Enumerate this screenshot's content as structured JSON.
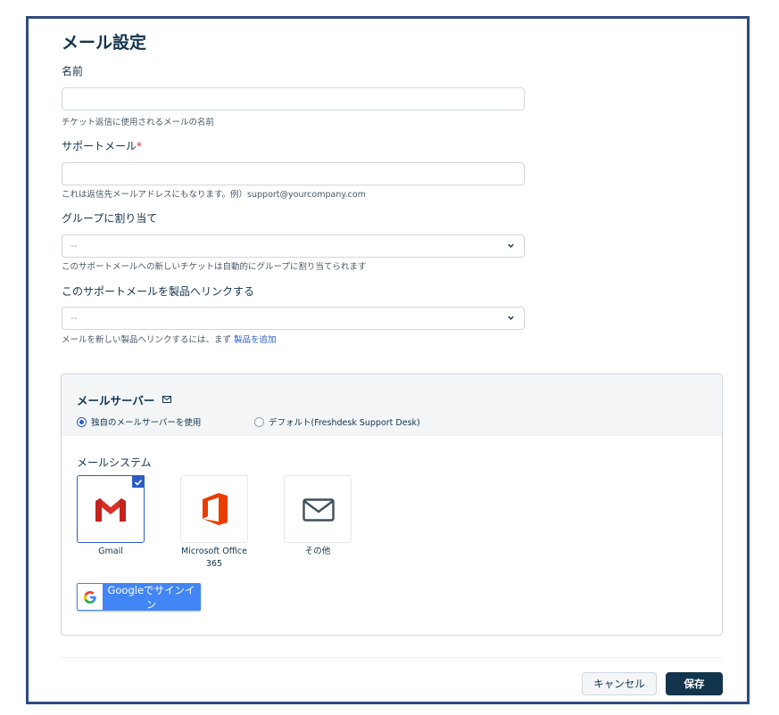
{
  "page": {
    "title": "メール設定"
  },
  "form": {
    "name": {
      "label": "名前",
      "value": "",
      "hint": "チケット返信に使用されるメールの名前"
    },
    "support_email": {
      "label": "サポートメール",
      "required_mark": "*",
      "value": "",
      "hint": "これは返信先メールアドレスにもなります。例）support@yourcompany.com"
    },
    "group": {
      "label": "グループに割り当て",
      "selected": "--",
      "hint": "このサポートメールへの新しいチケットは自動的にグループに割り当てられます"
    },
    "product": {
      "label": "このサポートメールを製品へリンクする",
      "selected": "--",
      "hint_prefix": "メールを新しい製品へリンクするには、まず ",
      "hint_link": "製品を追加"
    }
  },
  "mail_server": {
    "title": "メールサーバー",
    "icon": "envelope-icon",
    "options": [
      {
        "label": "独自のメールサーバーを使用",
        "selected": true
      },
      {
        "label": "デフォルト(Freshdesk Support Desk)",
        "selected": false
      }
    ],
    "system_label": "メールシステム",
    "systems": [
      {
        "name": "Gmail",
        "icon": "gmail-icon",
        "selected": true
      },
      {
        "name": "Microsoft Office 365",
        "icon": "office-icon",
        "selected": false
      },
      {
        "name": "その他",
        "icon": "mail-icon",
        "selected": false
      }
    ],
    "google_signin": "Googleでサインイン"
  },
  "footer": {
    "cancel": "キャンセル",
    "save": "保存"
  },
  "colors": {
    "accent": "#2c5cc5",
    "primary_dark": "#12344d",
    "frame_border": "#2e4a80",
    "google_blue": "#4285f4",
    "office_orange": "#eb3c00",
    "gmail_red": "#d93025"
  }
}
